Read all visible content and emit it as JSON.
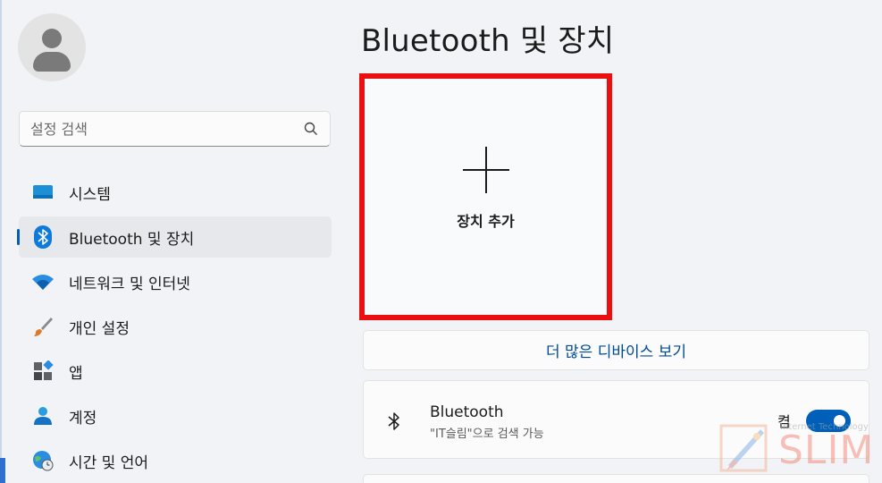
{
  "sidebar": {
    "search_placeholder": "설정 검색",
    "items": [
      {
        "label": "시스템",
        "icon": "system-icon"
      },
      {
        "label": "Bluetooth 및 장치",
        "icon": "bluetooth-icon",
        "active": true
      },
      {
        "label": "네트워크 및 인터넷",
        "icon": "wifi-icon"
      },
      {
        "label": "개인 설정",
        "icon": "brush-icon"
      },
      {
        "label": "앱",
        "icon": "apps-icon"
      },
      {
        "label": "계정",
        "icon": "account-icon"
      },
      {
        "label": "시간 및 언어",
        "icon": "globe-clock-icon"
      }
    ]
  },
  "main": {
    "title": "Bluetooth 및 장치",
    "add_device_label": "장치 추가",
    "more_devices_label": "더 많은 디바이스 보기",
    "bluetooth": {
      "title": "Bluetooth",
      "subtitle": "\"IT슬림\"으로 검색 가능",
      "state": "켬",
      "enabled": true
    }
  },
  "watermark": {
    "text": "SLIM",
    "sub": "Internet Technology"
  },
  "colors": {
    "accent": "#005fb8",
    "highlight_border": "#ec0f0f",
    "link": "#004a96"
  }
}
